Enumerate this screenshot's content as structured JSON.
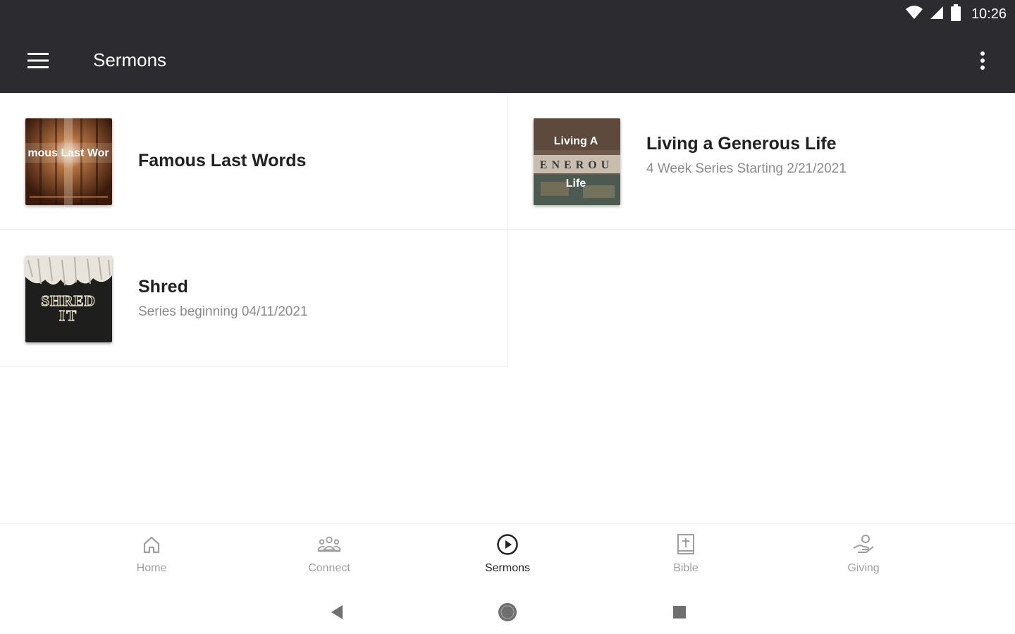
{
  "status_bar": {
    "time": "10:26",
    "icons": [
      "wifi-icon",
      "signal-icon",
      "battery-icon"
    ]
  },
  "app_bar": {
    "title": "Sermons",
    "menu_icon": "hamburger-menu-icon",
    "more_icon": "more-vertical-icon"
  },
  "sermons": [
    {
      "title": "Famous Last Words",
      "subtitle": "",
      "thumb_text": "mous Last Wor",
      "thumb_caption": ""
    },
    {
      "title": "Living a Generous Life",
      "subtitle": "4 Week Series Starting 2/21/2021",
      "thumb_text_top": "Living A",
      "thumb_text_mid": "ENEROU",
      "thumb_text_bottom": "Life"
    },
    {
      "title": "Shred",
      "subtitle": "Series beginning 04/11/2021",
      "thumb_text_top": "SHRED",
      "thumb_text_bottom": "IT"
    }
  ],
  "bottom_nav": [
    {
      "label": "Home",
      "icon": "home-icon",
      "active": false
    },
    {
      "label": "Connect",
      "icon": "people-icon",
      "active": false
    },
    {
      "label": "Sermons",
      "icon": "play-circle-icon",
      "active": true
    },
    {
      "label": "Bible",
      "icon": "bible-icon",
      "active": false
    },
    {
      "label": "Giving",
      "icon": "giving-hand-icon",
      "active": false
    }
  ],
  "system_nav": [
    "back-icon",
    "home-circle-icon",
    "recents-icon"
  ],
  "colors": {
    "app_bar": "#2c2b30",
    "active_nav": "#222222",
    "inactive_nav": "#9e9e9e"
  }
}
